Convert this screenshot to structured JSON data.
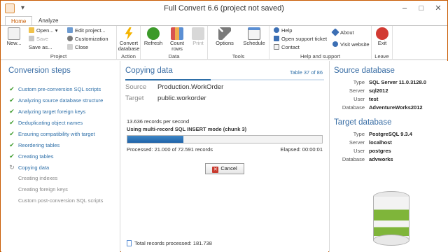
{
  "window": {
    "title": "Full Convert 6.6 (project not saved)",
    "minimize": "–",
    "maximize": "□",
    "close": "✕"
  },
  "tabs": [
    "Home",
    "Analyze"
  ],
  "ribbon": {
    "project": {
      "label": "Project",
      "new": "New...",
      "open": "Open...",
      "save": "Save",
      "save_as": "Save as...",
      "edit_project": "Edit project...",
      "customization": "Customization",
      "close": "Close"
    },
    "action": {
      "label": "Action",
      "convert": "Convert database"
    },
    "data": {
      "label": "Data",
      "refresh": "Refresh",
      "count_rows": "Count rows",
      "print": "Print"
    },
    "tools": {
      "label": "Tools",
      "options": "Options",
      "schedule": "Schedule"
    },
    "help": {
      "label": "Help and support",
      "help": "Help",
      "open_ticket": "Open support ticket",
      "contact": "Contact",
      "about": "About",
      "visit_website": "Visit website"
    },
    "leave": {
      "label": "Leave",
      "exit": "Exit"
    }
  },
  "left": {
    "title": "Conversion steps",
    "steps": [
      {
        "label": "Custom pre-conversion SQL scripts",
        "state": "done"
      },
      {
        "label": "Analyzing source database structure",
        "state": "done"
      },
      {
        "label": "Analyzing target foreign keys",
        "state": "done"
      },
      {
        "label": "Deduplicating object names",
        "state": "done"
      },
      {
        "label": "Ensuring compatibility with target",
        "state": "done"
      },
      {
        "label": "Reordering tables",
        "state": "done"
      },
      {
        "label": "Creating tables",
        "state": "done"
      },
      {
        "label": "Copying data",
        "state": "current"
      },
      {
        "label": "Creating indexes",
        "state": "pending"
      },
      {
        "label": "Creating foreign keys",
        "state": "pending"
      },
      {
        "label": "Custom post-conversion SQL scripts",
        "state": "pending"
      }
    ]
  },
  "center": {
    "title": "Copying data",
    "table_counter": "Table 37 of 86",
    "table_progress": 0.43,
    "source_label": "Source",
    "source_value": "Production.WorkOrder",
    "target_label": "Target",
    "target_value": "public.workorder",
    "rate": "13.636 records per second",
    "mode": "Using multi-record SQL INSERT mode (chunk 3)",
    "progress_fraction": 0.289,
    "processed": "Processed: 21.000 of 72.591 records",
    "elapsed": "Elapsed: 00:00:01",
    "cancel_label": "Cancel",
    "total": "Total records processed: 181.738"
  },
  "right": {
    "source_title": "Source database",
    "source": [
      {
        "k": "Type",
        "v": "SQL Server 11.0.3128.0"
      },
      {
        "k": "Server",
        "v": "sql2012"
      },
      {
        "k": "User",
        "v": "test"
      },
      {
        "k": "Database",
        "v": "AdventureWorks2012"
      }
    ],
    "target_title": "Target database",
    "target": [
      {
        "k": "Type",
        "v": "PostgreSQL 9.3.4"
      },
      {
        "k": "Server",
        "v": "localhost"
      },
      {
        "k": "User",
        "v": "postgres"
      },
      {
        "k": "Database",
        "v": "advworks"
      }
    ]
  },
  "colors": {
    "accent": "#c85a00",
    "link_blue": "#2e6fa8",
    "check_green": "#3c9a2a"
  }
}
